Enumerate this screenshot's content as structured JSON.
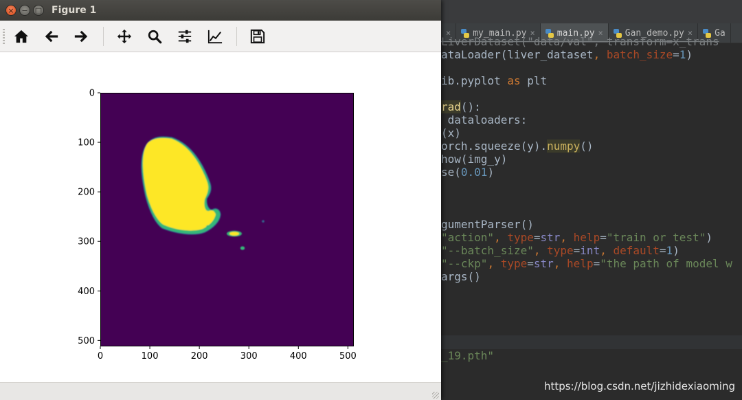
{
  "window": {
    "title": "Figure 1",
    "close_glyph": "×",
    "minimize_glyph": "−",
    "maximize_glyph": "□"
  },
  "toolbar": {
    "buttons": [
      {
        "name": "home",
        "icon": "home-icon"
      },
      {
        "name": "back",
        "icon": "arrow-left-icon"
      },
      {
        "name": "forward",
        "icon": "arrow-right-icon"
      },
      {
        "name": "pan",
        "icon": "move-icon"
      },
      {
        "name": "zoom",
        "icon": "search-icon"
      },
      {
        "name": "subplots",
        "icon": "sliders-icon"
      },
      {
        "name": "edit-axis",
        "icon": "line-chart-icon"
      },
      {
        "name": "save",
        "icon": "floppy-disk-icon"
      }
    ]
  },
  "figure": {
    "type": "image",
    "x_ticks": [
      "0",
      "100",
      "200",
      "300",
      "400",
      "500"
    ],
    "y_ticks": [
      "0",
      "100",
      "200",
      "300",
      "400",
      "500"
    ],
    "x_range": [
      0,
      512
    ],
    "y_range": [
      0,
      512
    ],
    "colormap": "viridis",
    "colors": {
      "background": "#440154",
      "foreground": "#fde725",
      "edge_mid": "#35b779",
      "edge_low": "#31688e"
    }
  },
  "ide": {
    "tabs": [
      {
        "label": "",
        "close": "×",
        "active": false
      },
      {
        "label": "my_main.py",
        "close": "×",
        "active": false
      },
      {
        "label": "main.py",
        "close": "×",
        "active": true
      },
      {
        "label": "Gan_demo.py",
        "close": "×",
        "active": false
      },
      {
        "label": "Ga",
        "close": "",
        "active": false
      }
    ],
    "code_lines": [
      "LiverDataset(\"data/val\", transform=x_trans",
      "ataLoader(liver_dataset, batch_size=1)",
      "",
      "ib.pyplot as plt",
      "",
      "rad():",
      " dataloaders:",
      "(x)",
      "orch.squeeze(y).numpy()",
      "how(img_y)",
      "se(0.01)",
      "",
      "",
      "",
      "gumentParser()",
      "\"action\", type=str, help=\"train or test\")",
      "\"--batch_size\", type=int, default=1)",
      "\"--ckp\", type=str, help=\"the path of model w",
      "args()"
    ],
    "console_text": "_19.pth\"",
    "watermark": "https://blog.csdn.net/jizhidexiaoming"
  }
}
